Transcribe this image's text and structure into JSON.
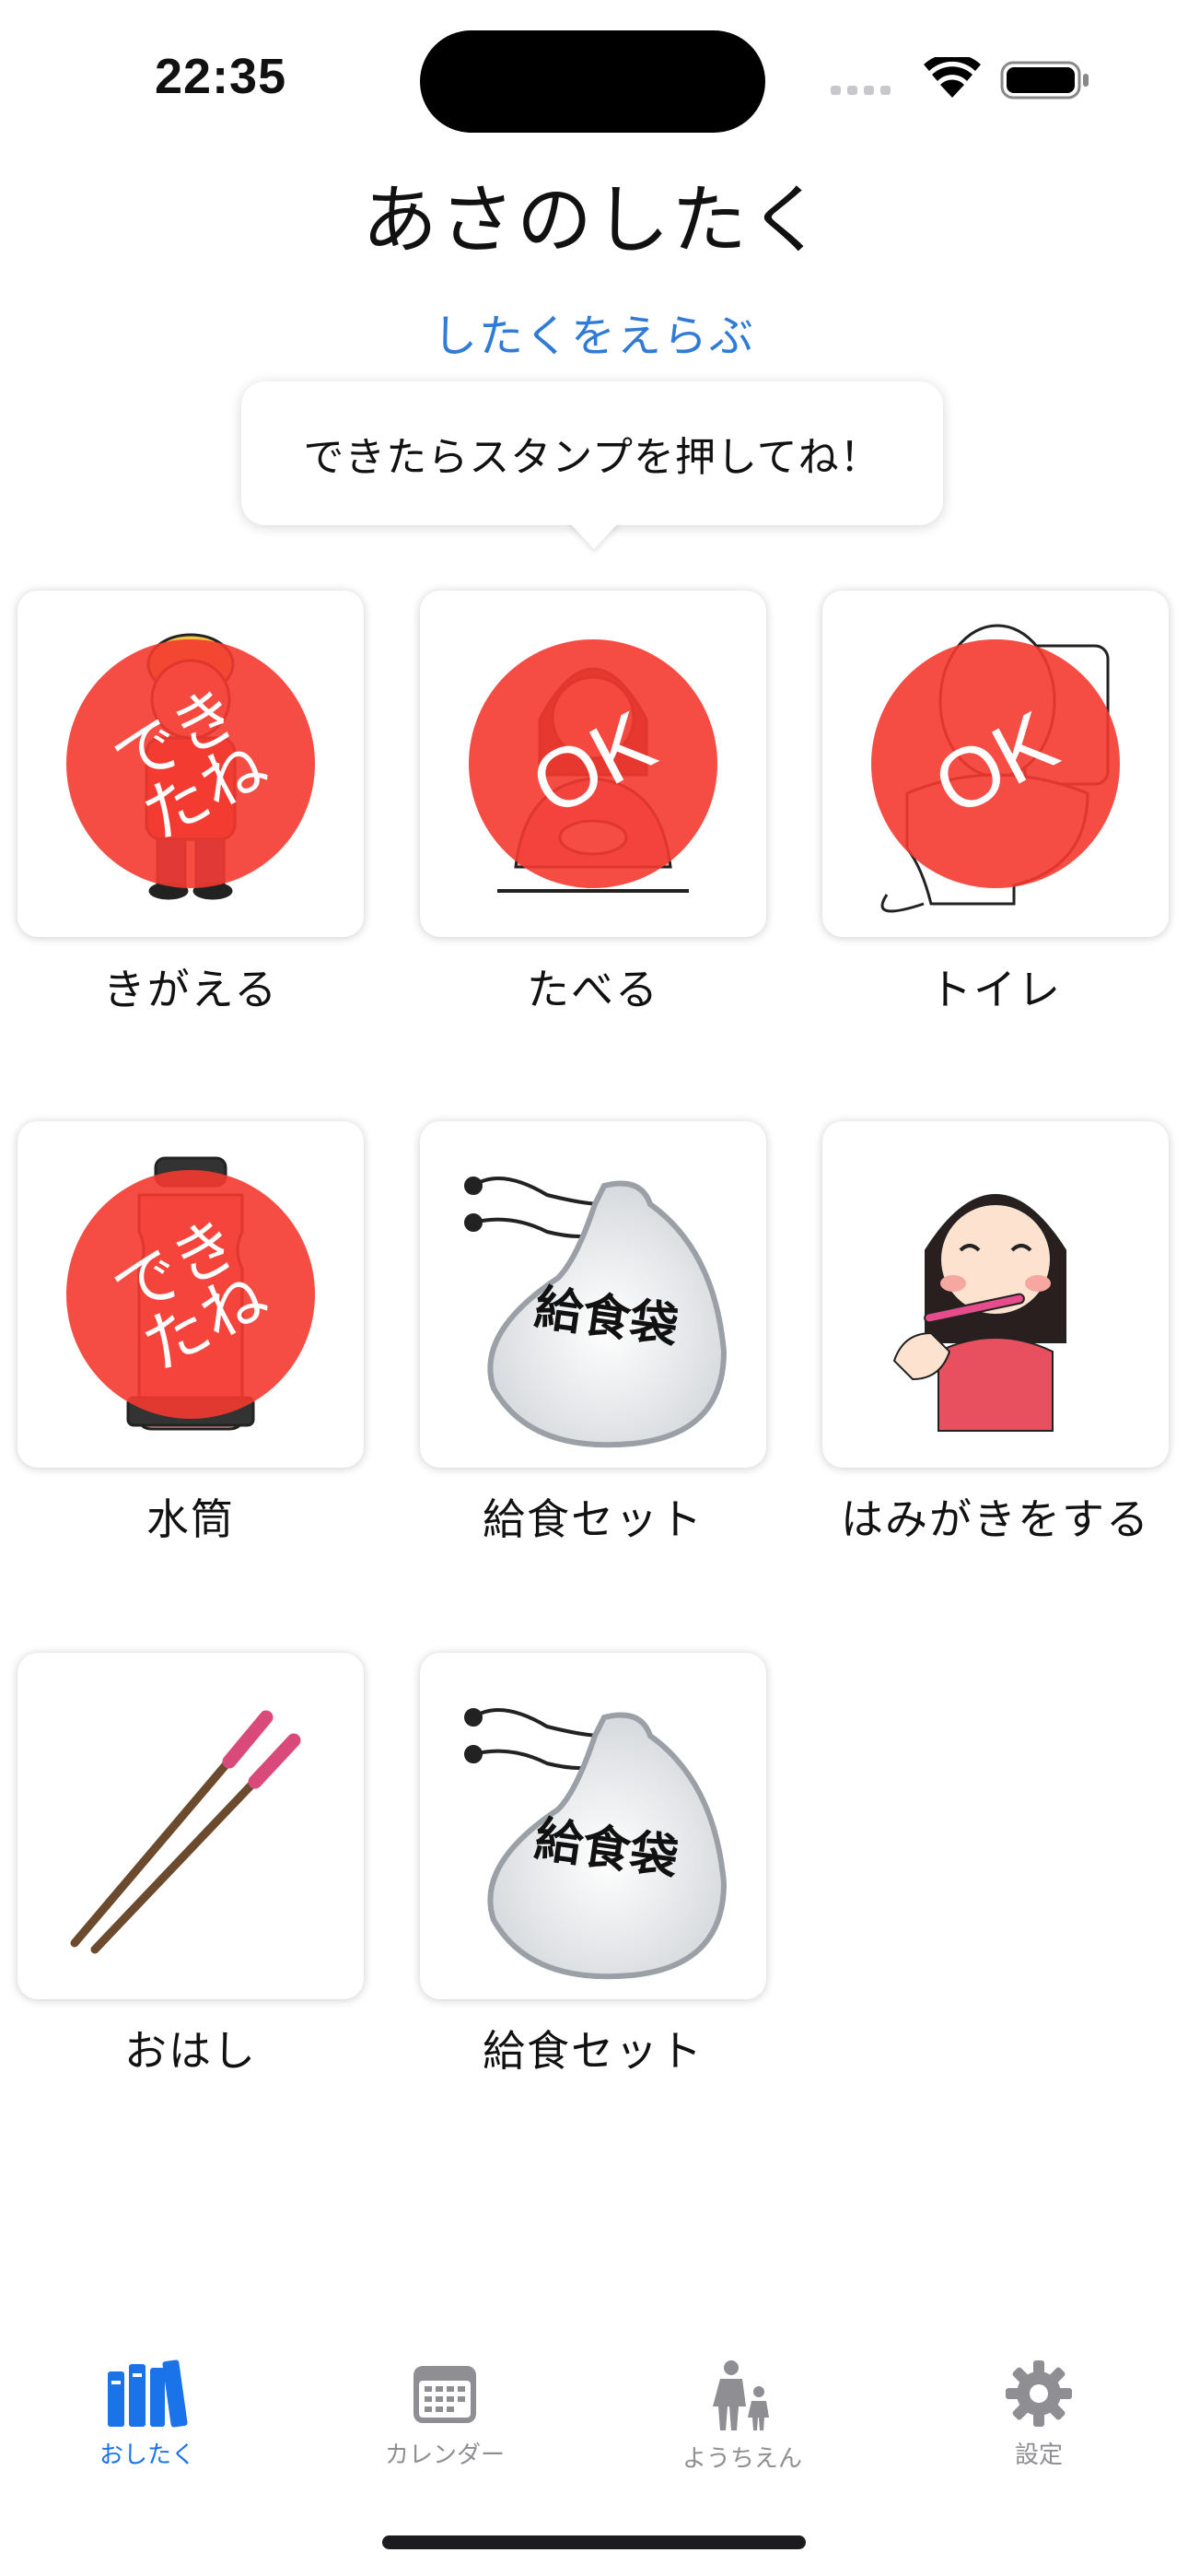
{
  "status_bar": {
    "time": "22:35"
  },
  "header": {
    "title": "あさのしたく",
    "select_link": "したくをえらぶ"
  },
  "tooltip": {
    "text": "できたらスタンプを押してね！"
  },
  "tasks": [
    {
      "label": "きがえる",
      "stamp": "できたね",
      "art": "kid-uniform"
    },
    {
      "label": "たべる",
      "stamp": "OK",
      "art": "girl-eating"
    },
    {
      "label": "トイレ",
      "stamp": "OK",
      "art": "toilet"
    },
    {
      "label": "水筒",
      "stamp": "できたね",
      "art": "water-bottle"
    },
    {
      "label": "給食セット",
      "stamp": "",
      "art": "lunch-bag",
      "art_text": "給食袋"
    },
    {
      "label": "はみがきをする",
      "stamp": "",
      "art": "girl-brushing-teeth"
    },
    {
      "label": "おはし",
      "stamp": "",
      "art": "chopsticks"
    },
    {
      "label": "給食セット",
      "stamp": "",
      "art": "lunch-bag",
      "art_text": "給食袋"
    }
  ],
  "tab_bar": {
    "tabs": [
      {
        "label": "おしたく",
        "icon": "books-icon",
        "active": true
      },
      {
        "label": "カレンダー",
        "icon": "calendar-icon",
        "active": false
      },
      {
        "label": "ようちえん",
        "icon": "parent-child-icon",
        "active": false
      },
      {
        "label": "設定",
        "icon": "gear-icon",
        "active": false
      }
    ]
  },
  "colors": {
    "accent": "#1a73e8",
    "link": "#2f7bd6",
    "stamp": "#f43830",
    "inactive": "#8e8e93"
  }
}
